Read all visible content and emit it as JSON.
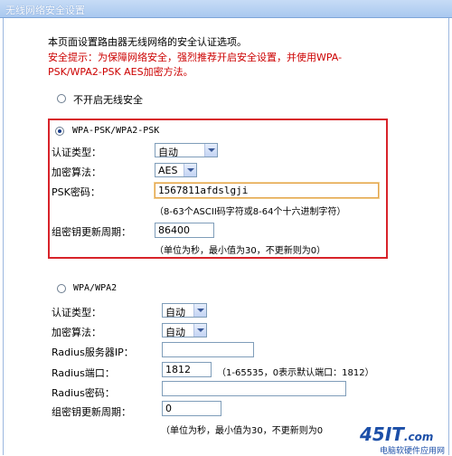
{
  "title": "无线网络安全设置",
  "intro": "本页面设置路由器无线网络的安全认证选项。",
  "warning_line1": "安全提示：为保障网络安全，强烈推荐开启安全设置，并使用WPA-",
  "warning_line2": "PSK/WPA2-PSK AES加密方法。",
  "options": {
    "disable": {
      "label": "不开启无线安全"
    },
    "wpa_psk": {
      "label": "WPA-PSK/WPA2-PSK",
      "auth_label": "认证类型：",
      "auth_value": "自动",
      "enc_label": "加密算法：",
      "enc_value": "AES",
      "psk_label": "PSK密码：",
      "psk_value": "1567811afdslgji",
      "psk_hint": "（8-63个ASCII码字符或8-64个十六进制字符）",
      "renew_label": "组密钥更新周期：",
      "renew_value": "86400",
      "renew_hint": "（单位为秒，最小值为30，不更新则为0）"
    },
    "wpa": {
      "label": "WPA/WPA2",
      "auth_label": "认证类型：",
      "auth_value": "自动",
      "enc_label": "加密算法：",
      "enc_value": "自动",
      "radius_ip_label": "Radius服务器IP：",
      "radius_ip_value": "",
      "radius_port_label": "Radius端口：",
      "radius_port_value": "1812",
      "radius_port_hint": "（1-65535，0表示默认端口：1812）",
      "radius_pwd_label": "Radius密码：",
      "radius_pwd_value": "",
      "renew_label": "组密钥更新周期：",
      "renew_value": "0",
      "renew_hint": "（单位为秒，最小值为30，不更新则为0"
    }
  },
  "watermark": {
    "logo": "45IT",
    "domain": ".com",
    "tagline": "电脑软硬件应用网"
  }
}
